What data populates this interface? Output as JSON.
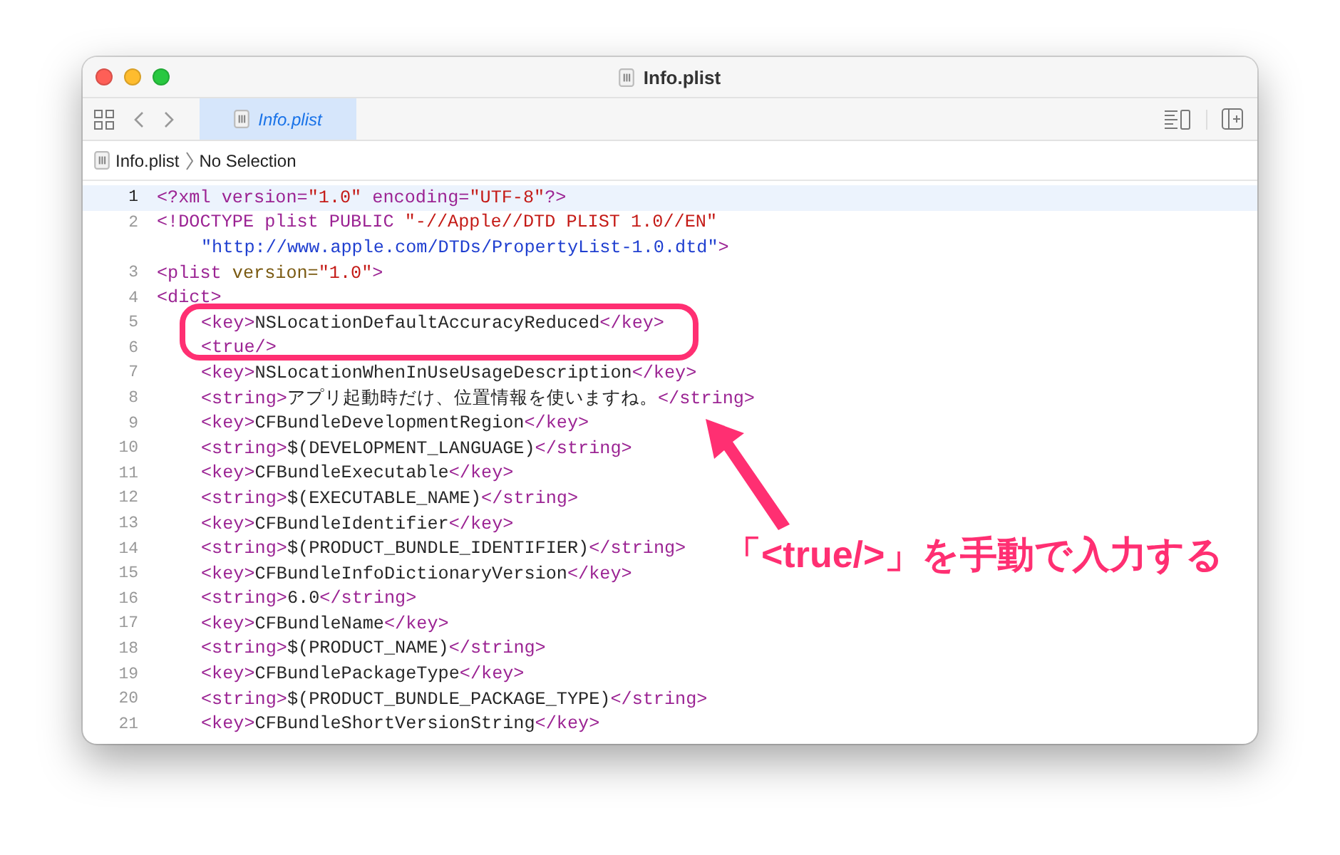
{
  "window": {
    "title": "Info.plist"
  },
  "tabs": [
    {
      "label": "Info.plist",
      "selected": true
    }
  ],
  "breadcrumb": {
    "file": "Info.plist",
    "location": "No Selection"
  },
  "editor": {
    "lines": [
      {
        "number": "1",
        "current": true,
        "tokens": [
          {
            "kind": "tag",
            "text": "<?xml "
          },
          {
            "kind": "tag",
            "text": "version="
          },
          {
            "kind": "string",
            "text": "\"1.0\""
          },
          {
            "kind": "tag",
            "text": " encoding="
          },
          {
            "kind": "string",
            "text": "\"UTF-8\""
          },
          {
            "kind": "tag",
            "text": "?>"
          }
        ]
      },
      {
        "number": "2",
        "current": false,
        "tokens": [
          {
            "kind": "tag",
            "text": "<!DOCTYPE plist PUBLIC "
          },
          {
            "kind": "string",
            "text": "\"-//Apple//DTD PLIST 1.0//EN\""
          }
        ],
        "wrap": [
          {
            "kind": "url",
            "text": "\"http://www.apple.com/DTDs/PropertyList-1.0.dtd\""
          },
          {
            "kind": "tag",
            "text": ">"
          }
        ]
      },
      {
        "number": "3",
        "current": false,
        "tokens": [
          {
            "kind": "tag",
            "text": "<plist "
          },
          {
            "kind": "attr",
            "text": "version="
          },
          {
            "kind": "string",
            "text": "\"1.0\""
          },
          {
            "kind": "tag",
            "text": ">"
          }
        ]
      },
      {
        "number": "4",
        "current": false,
        "tokens": [
          {
            "kind": "tag",
            "text": "<dict>"
          }
        ],
        "children": [
          {
            "number": "5",
            "current": false,
            "tokens": [
              {
                "kind": "tag",
                "text": "<key>"
              },
              {
                "kind": "text",
                "text": "NSLocationDefaultAccuracyReduced"
              },
              {
                "kind": "tag",
                "text": "</key>"
              }
            ]
          },
          {
            "number": "6",
            "current": false,
            "tokens": [
              {
                "kind": "tag",
                "text": "<true/>"
              }
            ]
          },
          {
            "number": "7",
            "current": false,
            "tokens": [
              {
                "kind": "tag",
                "text": "<key>"
              },
              {
                "kind": "text",
                "text": "NSLocationWhenInUseUsageDescription"
              },
              {
                "kind": "tag",
                "text": "</key>"
              }
            ]
          },
          {
            "number": "8",
            "current": false,
            "tokens": [
              {
                "kind": "tag",
                "text": "<string>"
              },
              {
                "kind": "text",
                "text": "アプリ起動時だけ、位置情報を使いますね。"
              },
              {
                "kind": "tag",
                "text": "</string>"
              }
            ]
          },
          {
            "number": "9",
            "current": false,
            "tokens": [
              {
                "kind": "tag",
                "text": "<key>"
              },
              {
                "kind": "text",
                "text": "CFBundleDevelopmentRegion"
              },
              {
                "kind": "tag",
                "text": "</key>"
              }
            ]
          },
          {
            "number": "10",
            "current": false,
            "tokens": [
              {
                "kind": "tag",
                "text": "<string>"
              },
              {
                "kind": "text",
                "text": "$(DEVELOPMENT_LANGUAGE)"
              },
              {
                "kind": "tag",
                "text": "</string>"
              }
            ]
          },
          {
            "number": "11",
            "current": false,
            "tokens": [
              {
                "kind": "tag",
                "text": "<key>"
              },
              {
                "kind": "text",
                "text": "CFBundleExecutable"
              },
              {
                "kind": "tag",
                "text": "</key>"
              }
            ]
          },
          {
            "number": "12",
            "current": false,
            "tokens": [
              {
                "kind": "tag",
                "text": "<string>"
              },
              {
                "kind": "text",
                "text": "$(EXECUTABLE_NAME)"
              },
              {
                "kind": "tag",
                "text": "</string>"
              }
            ]
          },
          {
            "number": "13",
            "current": false,
            "tokens": [
              {
                "kind": "tag",
                "text": "<key>"
              },
              {
                "kind": "text",
                "text": "CFBundleIdentifier"
              },
              {
                "kind": "tag",
                "text": "</key>"
              }
            ]
          },
          {
            "number": "14",
            "current": false,
            "tokens": [
              {
                "kind": "tag",
                "text": "<string>"
              },
              {
                "kind": "text",
                "text": "$(PRODUCT_BUNDLE_IDENTIFIER)"
              },
              {
                "kind": "tag",
                "text": "</string>"
              }
            ]
          },
          {
            "number": "15",
            "current": false,
            "tokens": [
              {
                "kind": "tag",
                "text": "<key>"
              },
              {
                "kind": "text",
                "text": "CFBundleInfoDictionaryVersion"
              },
              {
                "kind": "tag",
                "text": "</key>"
              }
            ]
          },
          {
            "number": "16",
            "current": false,
            "tokens": [
              {
                "kind": "tag",
                "text": "<string>"
              },
              {
                "kind": "text",
                "text": "6.0"
              },
              {
                "kind": "tag",
                "text": "</string>"
              }
            ]
          },
          {
            "number": "17",
            "current": false,
            "tokens": [
              {
                "kind": "tag",
                "text": "<key>"
              },
              {
                "kind": "text",
                "text": "CFBundleName"
              },
              {
                "kind": "tag",
                "text": "</key>"
              }
            ]
          },
          {
            "number": "18",
            "current": false,
            "tokens": [
              {
                "kind": "tag",
                "text": "<string>"
              },
              {
                "kind": "text",
                "text": "$(PRODUCT_NAME)"
              },
              {
                "kind": "tag",
                "text": "</string>"
              }
            ]
          },
          {
            "number": "19",
            "current": false,
            "tokens": [
              {
                "kind": "tag",
                "text": "<key>"
              },
              {
                "kind": "text",
                "text": "CFBundlePackageType"
              },
              {
                "kind": "tag",
                "text": "</key>"
              }
            ]
          },
          {
            "number": "20",
            "current": false,
            "tokens": [
              {
                "kind": "tag",
                "text": "<string>"
              },
              {
                "kind": "text",
                "text": "$(PRODUCT_BUNDLE_PACKAGE_TYPE)"
              },
              {
                "kind": "tag",
                "text": "</string>"
              }
            ]
          },
          {
            "number": "21",
            "current": false,
            "tokens": [
              {
                "kind": "tag",
                "text": "<key>"
              },
              {
                "kind": "text",
                "text": "CFBundleShortVersionString"
              },
              {
                "kind": "tag",
                "text": "</key>"
              }
            ]
          }
        ]
      }
    ]
  },
  "annotation": {
    "text": "「<true/>」を手動で入力する"
  }
}
